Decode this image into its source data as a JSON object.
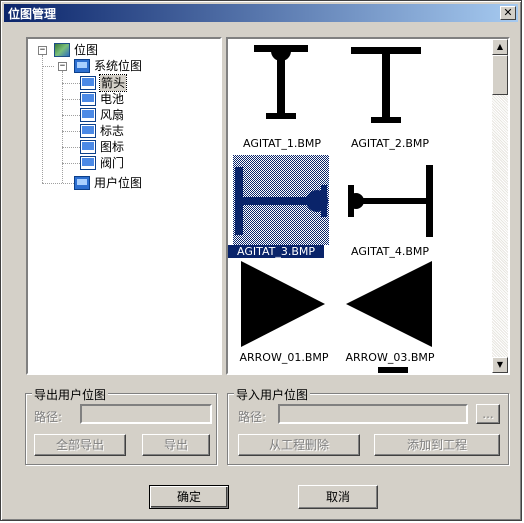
{
  "window": {
    "title": "位图管理",
    "close_glyph": "✕"
  },
  "tree": {
    "root": {
      "label": "位图",
      "expander": "−"
    },
    "system": {
      "label": "系统位图",
      "expander": "−"
    },
    "items": [
      {
        "label": "箭头",
        "selected": true
      },
      {
        "label": "电池",
        "selected": false
      },
      {
        "label": "风扇",
        "selected": false
      },
      {
        "label": "标志",
        "selected": false
      },
      {
        "label": "图标",
        "selected": false
      },
      {
        "label": "阀门",
        "selected": false
      }
    ],
    "user": {
      "label": "用户位图"
    }
  },
  "thumbnails": [
    {
      "name": "AGITAT_1.BMP",
      "selected": false
    },
    {
      "name": "AGITAT_2.BMP",
      "selected": false
    },
    {
      "name": "AGITAT_3.BMP",
      "selected": true
    },
    {
      "name": "AGITAT_4.BMP",
      "selected": false
    },
    {
      "name": "ARROW_01.BMP",
      "selected": false
    },
    {
      "name": "ARROW_03.BMP",
      "selected": false
    }
  ],
  "export_group": {
    "title": "导出用户位图",
    "path_label": "路径:",
    "path_value": "",
    "export_all": "全部导出",
    "export": "导出"
  },
  "import_group": {
    "title": "导入用户位图",
    "path_label": "路径:",
    "path_value": "",
    "browse": "...",
    "remove": "从工程删除",
    "add": "添加到工程"
  },
  "buttons": {
    "ok": "确定",
    "cancel": "取消"
  },
  "colors": {
    "title_start": "#0a246a",
    "title_end": "#a6caf0",
    "selection": "#0a246a",
    "face": "#d4d0c8"
  }
}
